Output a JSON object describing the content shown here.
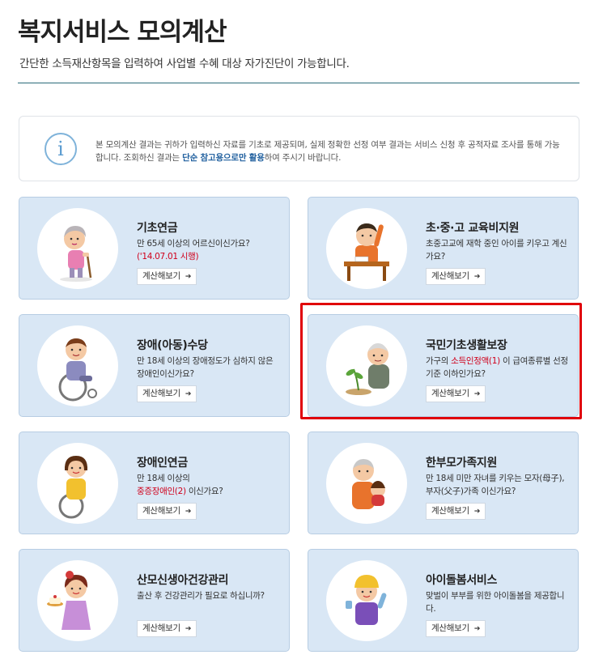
{
  "header": {
    "title": "복지서비스 모의계산",
    "subtitle": "간단한 소득재산항목을 입력하여 사업별 수혜 대상 자가진단이 가능합니다."
  },
  "notice": {
    "icon": "info-icon",
    "text_before": "본 모의계산 결과는 귀하가 입력하신 자료를 기초로 제공되며, 실제 정확한 선정 여부 결과는 서비스 신청 후 공적자료 조사를 통해 가능합니다. 조회하신 결과는 ",
    "text_bold": "단순 참고용으로만 활용",
    "text_after": "하여 주시기 바랍니다."
  },
  "colors": {
    "card_bg": "#d9e7f5",
    "highlight": "#e0000a",
    "emphasis_red": "#d0001b",
    "notice_bold": "#1f5f9e"
  },
  "cards": [
    {
      "title": "기초연금",
      "desc_1": "만 65세 이상의 어르신이신가요?",
      "desc_red": "('14.07.01 시행)",
      "desc_2": "",
      "button": "계산해보기",
      "icon": "elderly-woman-cane-icon"
    },
    {
      "title": "초·중·고 교육비지원",
      "desc_1": "초중고교에 재학 중인 아이를 키우고 계신가요?",
      "desc_red": "",
      "desc_2": "",
      "button": "계산해보기",
      "icon": "student-desk-icon"
    },
    {
      "title": "장애(아동)수당",
      "desc_1": "만 18세 이상의 장애정도가 심하지 않은 장애인이신가요?",
      "desc_red": "",
      "desc_2": "",
      "button": "계산해보기",
      "icon": "wheelchair-boy-icon"
    },
    {
      "title": "국민기초생활보장",
      "desc_1": "가구의 ",
      "desc_red": "소득인정액(1)",
      "desc_2": " 이 급여종류별 선정기준 이하인가요?",
      "button": "계산해보기",
      "icon": "elderly-man-plant-icon"
    },
    {
      "title": "장애인연금",
      "desc_1": "만 18세 이상의",
      "desc_red": "중증장애인(2)",
      "desc_2": " 이신가요?",
      "button": "계산해보기",
      "icon": "wheelchair-woman-icon"
    },
    {
      "title": "한부모가족지원",
      "desc_1": "만 18세 미만 자녀를 키우는 모자(母子), 부자(父子)가족 이신가요?",
      "desc_red": "",
      "desc_2": "",
      "button": "계산해보기",
      "icon": "grandparent-child-icon"
    },
    {
      "title": "산모신생아건강관리",
      "desc_1": "출산 후 건강관리가 필요로 하십니까?",
      "desc_red": "",
      "desc_2": "",
      "button": "계산해보기",
      "icon": "mother-cake-icon"
    },
    {
      "title": "아이돌봄서비스",
      "desc_1": "맞벌이 부부를 위한 아이돌봄을 제공합니다.",
      "desc_red": "",
      "desc_2": "",
      "button": "계산해보기",
      "icon": "child-yellow-hat-icon"
    }
  ]
}
